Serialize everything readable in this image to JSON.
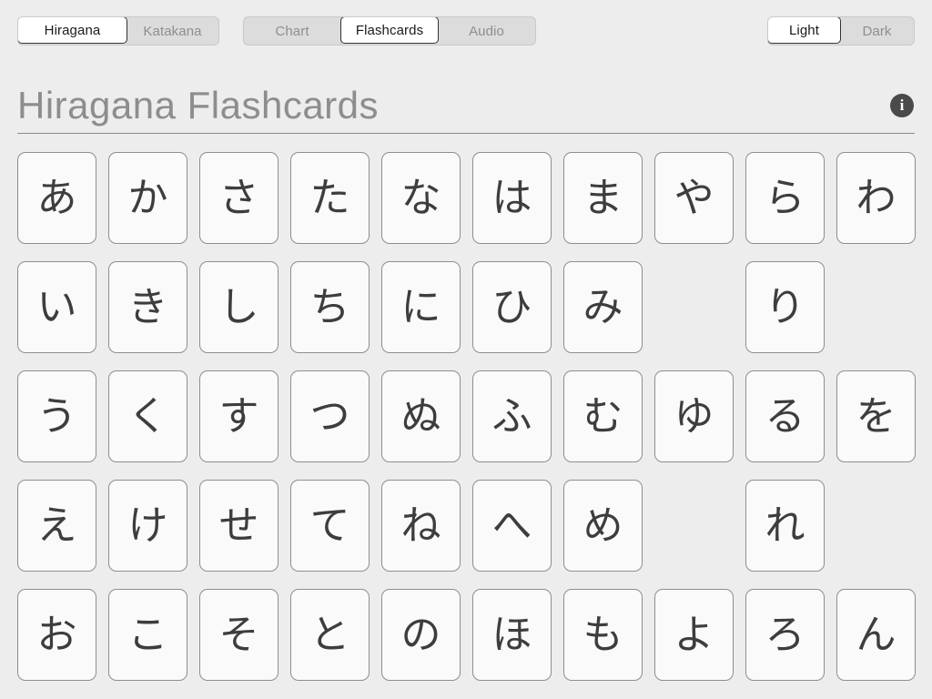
{
  "toolbar": {
    "script_group": {
      "name": "script-selector",
      "options": [
        "Hiragana",
        "Katakana"
      ],
      "selected": "Hiragana"
    },
    "mode_group": {
      "name": "mode-selector",
      "options": [
        "Chart",
        "Flashcards",
        "Audio"
      ],
      "selected": "Flashcards"
    },
    "theme_group": {
      "name": "theme-selector",
      "options": [
        "Light",
        "Dark"
      ],
      "selected": "Light"
    }
  },
  "header": {
    "title": "Hiragana Flashcards",
    "info_icon": "info-icon",
    "info_glyph": "i"
  },
  "colors": {
    "page_background": "#ededed",
    "card_background": "#fafafa",
    "card_border": "#8e8e8e",
    "title_text": "#8d8d8d",
    "glyph_text": "#3d3d3d",
    "segment_inactive_background": "#dcdcdc",
    "segment_inactive_text": "#8e8e8e",
    "segment_active_background": "#ffffff",
    "segment_active_text": "#1a1a1a",
    "segment_active_border": "#333333",
    "divider": "#8a8a8a",
    "info_icon_background": "#4a4a4a"
  },
  "grid": {
    "columns": 10,
    "rows": 5,
    "cells": [
      "あ",
      "か",
      "さ",
      "た",
      "な",
      "は",
      "ま",
      "や",
      "ら",
      "わ",
      "い",
      "き",
      "し",
      "ち",
      "に",
      "ひ",
      "み",
      "",
      "り",
      "",
      "う",
      "く",
      "す",
      "つ",
      "ぬ",
      "ふ",
      "む",
      "ゆ",
      "る",
      "を",
      "え",
      "け",
      "せ",
      "て",
      "ね",
      "へ",
      "め",
      "",
      "れ",
      "",
      "お",
      "こ",
      "そ",
      "と",
      "の",
      "ほ",
      "も",
      "よ",
      "ろ",
      "ん"
    ]
  }
}
